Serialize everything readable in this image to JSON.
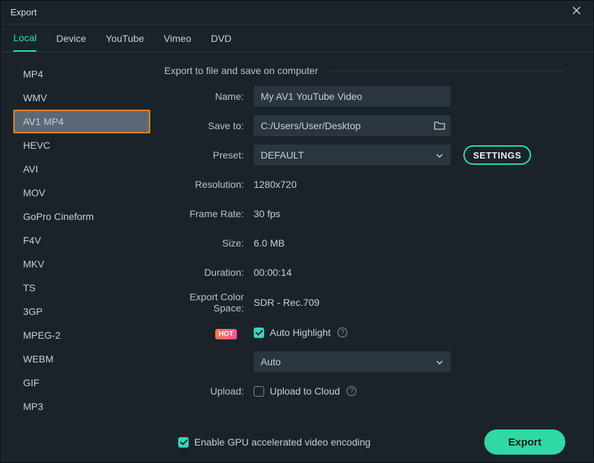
{
  "title": "Export",
  "tabs": [
    "Local",
    "Device",
    "YouTube",
    "Vimeo",
    "DVD"
  ],
  "tab_active": 0,
  "formats": [
    "MP4",
    "WMV",
    "AV1 MP4",
    "HEVC",
    "AVI",
    "MOV",
    "GoPro Cineform",
    "F4V",
    "MKV",
    "TS",
    "3GP",
    "MPEG-2",
    "WEBM",
    "GIF",
    "MP3"
  ],
  "format_selected": 2,
  "section_title": "Export to file and save on computer",
  "labels": {
    "name": "Name:",
    "save_to": "Save to:",
    "preset": "Preset:",
    "resolution": "Resolution:",
    "frame_rate": "Frame Rate:",
    "size": "Size:",
    "duration": "Duration:",
    "color_space": "Export Color Space:",
    "upload": "Upload:"
  },
  "values": {
    "name": "My AV1 YouTube Video",
    "save_to": "C:/Users/User/Desktop",
    "preset": "DEFAULT",
    "resolution": "1280x720",
    "frame_rate": "30 fps",
    "size": "6.0 MB",
    "duration": "00:00:14",
    "color_space": "SDR - Rec.709",
    "settings": "SETTINGS",
    "hot": "HOT",
    "auto_highlight": "Auto Highlight",
    "highlight_mode": "Auto",
    "upload_cloud": "Upload to Cloud",
    "gpu": "Enable GPU accelerated video encoding",
    "export": "Export"
  },
  "checks": {
    "auto_highlight": true,
    "upload_cloud": false,
    "gpu": true
  }
}
